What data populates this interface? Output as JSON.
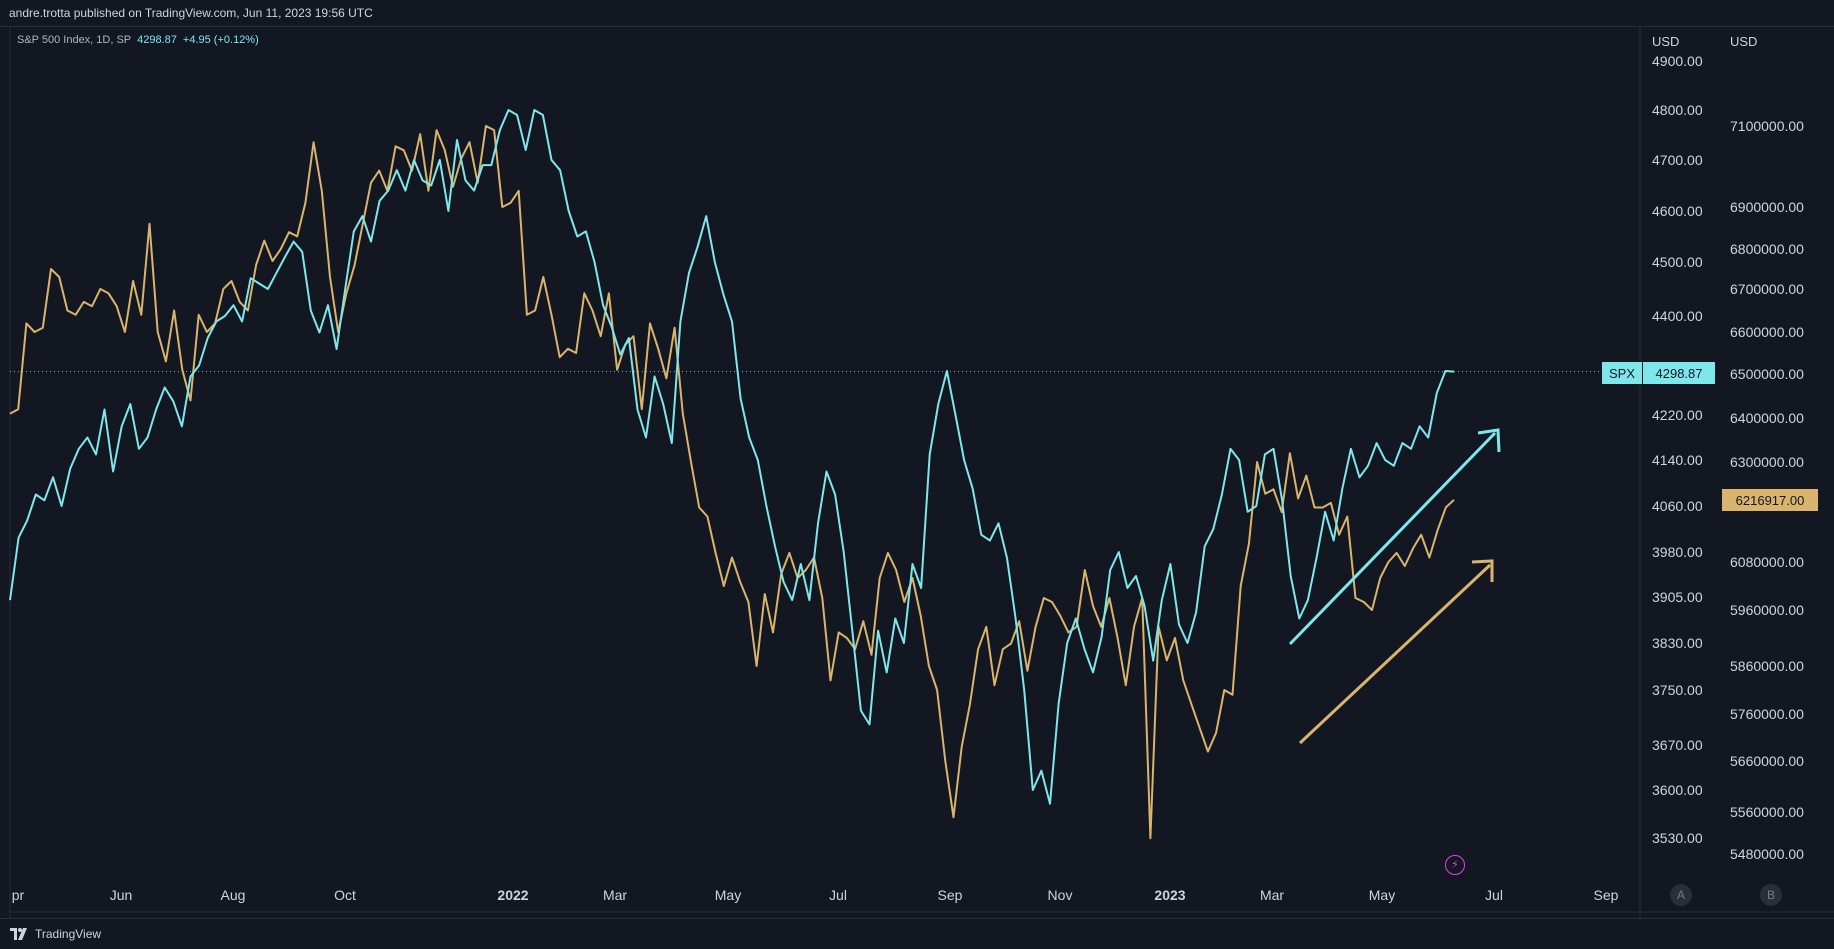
{
  "header": {
    "published_text": "andre.trotta published on TradingView.com, Jun 11, 2023 19:56 UTC"
  },
  "legend": {
    "symbol_info": "S&P 500 Index, 1D, SP",
    "last": "4298.87",
    "change": "+4.95 (+0.12%)"
  },
  "footer": {
    "brand": "TradingView"
  },
  "buttons": {
    "a": "A",
    "b": "B"
  },
  "colors": {
    "spx": "#7ee7ec",
    "fund": "#d9b46c",
    "background": "#131722",
    "grid_border": "#2a2e39"
  },
  "chart_data": {
    "type": "line",
    "x_ticks": [
      {
        "label": "pr",
        "major": false
      },
      {
        "label": "Jun",
        "major": false
      },
      {
        "label": "Aug",
        "major": false
      },
      {
        "label": "Oct",
        "major": false
      },
      {
        "label": "2022",
        "major": true
      },
      {
        "label": "Mar",
        "major": false
      },
      {
        "label": "May",
        "major": false
      },
      {
        "label": "Jul",
        "major": false
      },
      {
        "label": "Sep",
        "major": false
      },
      {
        "label": "Nov",
        "major": false
      },
      {
        "label": "2023",
        "major": true
      },
      {
        "label": "Mar",
        "major": false
      },
      {
        "label": "May",
        "major": false
      },
      {
        "label": "Jul",
        "major": false
      },
      {
        "label": "Sep",
        "major": false
      }
    ],
    "left_axis": {
      "currency": "USD",
      "ticks": [
        "4900.00",
        "4800.00",
        "4700.00",
        "4600.00",
        "4500.00",
        "4400.00",
        "4220.00",
        "4140.00",
        "4060.00",
        "3980.00",
        "3905.00",
        "3830.00",
        "3750.00",
        "3670.00",
        "3600.00",
        "3530.00"
      ]
    },
    "right_axis": {
      "currency": "USD",
      "ticks": [
        "7100000.00",
        "6900000.00",
        "6800000.00",
        "6700000.00",
        "6600000.00",
        "6500000.00",
        "6400000.00",
        "6300000.00",
        "6080000.00",
        "5960000.00",
        "5860000.00",
        "5760000.00",
        "5660000.00",
        "5560000.00",
        "5480000.00"
      ]
    },
    "series": [
      {
        "name": "SPX",
        "last_value": "4298.87",
        "values": [
          3900,
          4005,
          4035,
          4080,
          4070,
          4110,
          4060,
          4125,
          4160,
          4180,
          4150,
          4230,
          4120,
          4200,
          4240,
          4160,
          4180,
          4230,
          4270,
          4245,
          4200,
          4290,
          4310,
          4360,
          4390,
          4400,
          4420,
          4390,
          4470,
          4460,
          4450,
          4480,
          4510,
          4540,
          4520,
          4410,
          4370,
          4420,
          4340,
          4450,
          4560,
          4590,
          4540,
          4620,
          4640,
          4680,
          4640,
          4700,
          4660,
          4650,
          4700,
          4600,
          4740,
          4660,
          4640,
          4690,
          4690,
          4760,
          4800,
          4790,
          4720,
          4800,
          4790,
          4700,
          4680,
          4600,
          4550,
          4560,
          4500,
          4420,
          4380,
          4330,
          4360,
          4230,
          4180,
          4290,
          4240,
          4170,
          4390,
          4480,
          4530,
          4590,
          4500,
          4440,
          4390,
          4250,
          4180,
          4140,
          4060,
          3990,
          3930,
          3900,
          3960,
          3900,
          4030,
          4120,
          4080,
          3980,
          3850,
          3720,
          3700,
          3850,
          3780,
          3870,
          3830,
          3960,
          3920,
          4150,
          4240,
          4300,
          4220,
          4140,
          4090,
          4010,
          4000,
          4030,
          3970,
          3870,
          3750,
          3600,
          3630,
          3580,
          3730,
          3830,
          3870,
          3820,
          3780,
          3840,
          3950,
          3980,
          3920,
          3940,
          3890,
          3800,
          3900,
          3960,
          3860,
          3830,
          3880,
          3990,
          4020,
          4080,
          4160,
          4140,
          4050,
          4060,
          4150,
          4160,
          4070,
          3940,
          3870,
          3900,
          3970,
          4050,
          4000,
          4090,
          4160,
          4110,
          4130,
          4170,
          4140,
          4130,
          4170,
          4160,
          4200,
          4180,
          4260,
          4300,
          4298.87
        ]
      },
      {
        "name": "6216917.00",
        "last_value": "6216917.00",
        "values": [
          6410000,
          6420000,
          6620000,
          6600000,
          6610000,
          6750000,
          6730000,
          6650000,
          6640000,
          6670000,
          6660000,
          6700000,
          6690000,
          6660000,
          6600000,
          6720000,
          6640000,
          6860000,
          6600000,
          6530000,
          6650000,
          6510000,
          6440000,
          6640000,
          6600000,
          6620000,
          6700000,
          6720000,
          6670000,
          6650000,
          6760000,
          6820000,
          6770000,
          6800000,
          6840000,
          6830000,
          6910000,
          7060000,
          6940000,
          6730000,
          6600000,
          6690000,
          6760000,
          6860000,
          6960000,
          6990000,
          6940000,
          7050000,
          7040000,
          6990000,
          7080000,
          6940000,
          7090000,
          7040000,
          6950000,
          7020000,
          7060000,
          6960000,
          7100000,
          7090000,
          6900000,
          6910000,
          6940000,
          6640000,
          6650000,
          6730000,
          6640000,
          6540000,
          6560000,
          6550000,
          6690000,
          6650000,
          6590000,
          6690000,
          6510000,
          6570000,
          6590000,
          6420000,
          6620000,
          6560000,
          6490000,
          6610000,
          6410000,
          6300000,
          6200000,
          6180000,
          6100000,
          6020000,
          6090000,
          6030000,
          5980000,
          5860000,
          6000000,
          5920000,
          6050000,
          6100000,
          6040000,
          6060000,
          6090000,
          5990000,
          5830000,
          5920000,
          5910000,
          5890000,
          5940000,
          5880000,
          6040000,
          6100000,
          6060000,
          5980000,
          6040000,
          5950000,
          5860000,
          5810000,
          5660000,
          5550000,
          5690000,
          5780000,
          5890000,
          5930000,
          5820000,
          5890000,
          5900000,
          5940000,
          5850000,
          5930000,
          5990000,
          5980000,
          5950000,
          5920000,
          5930000,
          6060000,
          5970000,
          5930000,
          5990000,
          5910000,
          5820000,
          5930000,
          5990000,
          5510000,
          5930000,
          5870000,
          5910000,
          5830000,
          5780000,
          5730000,
          5680000,
          5720000,
          5810000,
          5800000,
          6020000,
          6120000,
          6300000,
          6230000,
          6240000,
          6190000,
          6320000,
          6220000,
          6270000,
          6200000,
          6200000,
          6210000,
          6140000,
          6180000,
          5990000,
          5980000,
          5960000,
          6040000,
          6080000,
          6100000,
          6070000,
          6110000,
          6140000,
          6090000,
          6150000,
          6200000,
          6216917
        ]
      }
    ]
  }
}
